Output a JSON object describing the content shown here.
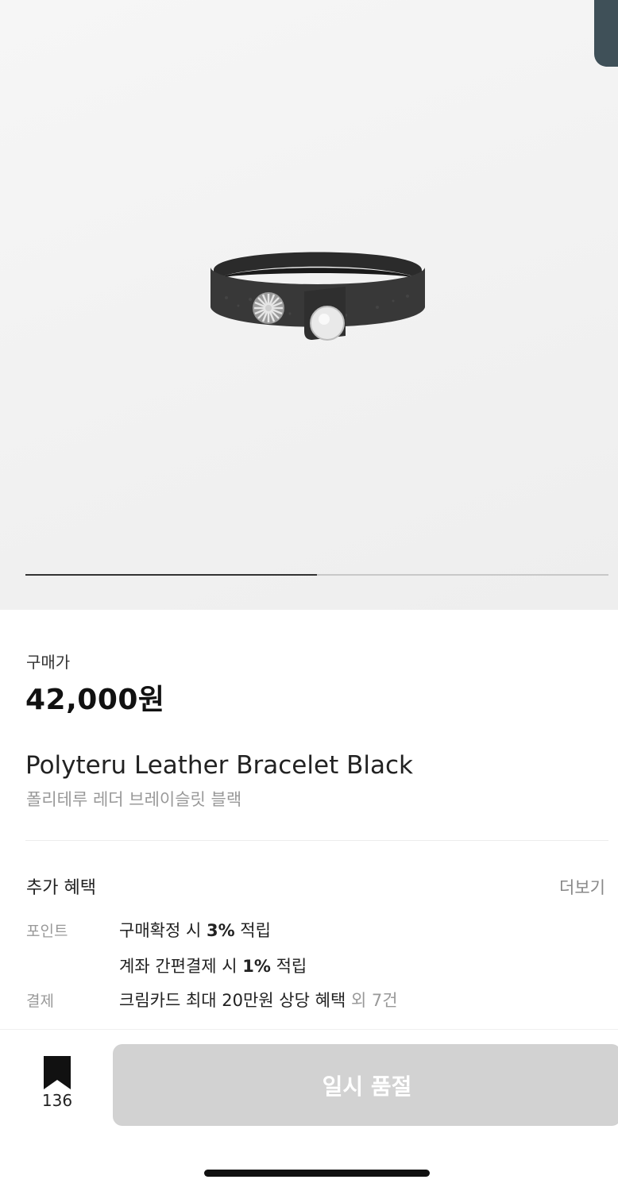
{
  "gallery": {
    "progress": 0.5
  },
  "price": {
    "label": "구매가",
    "value": "42,000원"
  },
  "product": {
    "name_en": "Polyteru Leather Bracelet Black",
    "name_ko": "폴리테루 레더 브레이슬릿 블랙"
  },
  "benefits": {
    "title": "추가 혜택",
    "more": "더보기",
    "point": {
      "label": "포인트",
      "line1": {
        "pre": "구매확정 시 ",
        "pct": "3%",
        "post": " 적립"
      },
      "line2": {
        "pre": "계좌 간편결제 시 ",
        "pct": "1%",
        "post": " 적립"
      }
    },
    "payment": {
      "label": "결제",
      "text": "크림카드 최대 20만원 상당 혜택",
      "extra": " 외 7건"
    }
  },
  "bottom_bar": {
    "bookmark_count": "136",
    "button_label": "일시 품절",
    "bookmark_icon": "bookmark-filled-icon"
  },
  "colors": {
    "button_disabled": "#d2d2d2",
    "accent_dark": "#3f5058",
    "muted_text": "#999999"
  }
}
